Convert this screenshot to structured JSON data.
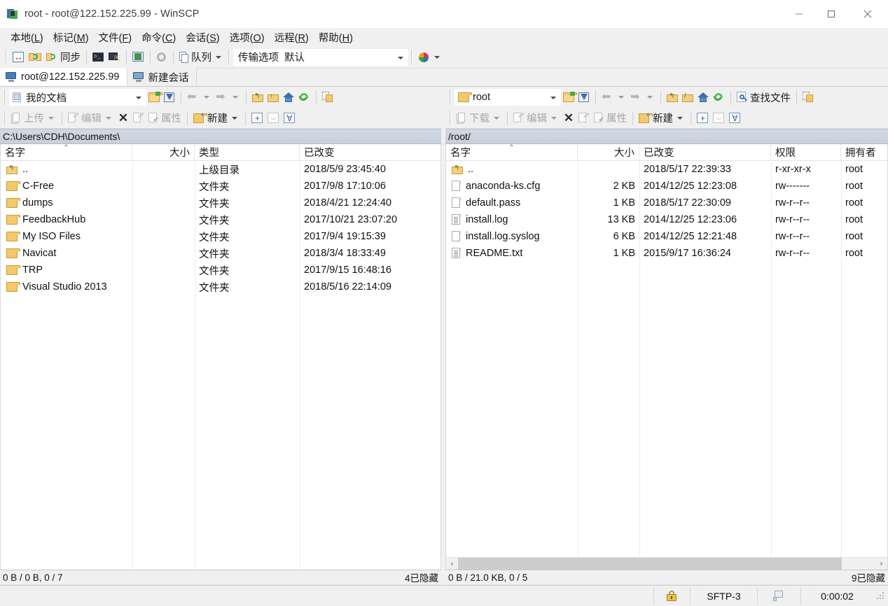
{
  "window": {
    "title": "root - root@122.152.225.99 - WinSCP",
    "app_icon": "winscp-icon",
    "minimize": "–",
    "maximize": "□",
    "close": "✕"
  },
  "menubar": [
    {
      "label": "本地",
      "accel": "L"
    },
    {
      "label": "标记",
      "accel": "M"
    },
    {
      "label": "文件",
      "accel": "F"
    },
    {
      "label": "命令",
      "accel": "C"
    },
    {
      "label": "会话",
      "accel": "S"
    },
    {
      "label": "选项",
      "accel": "O"
    },
    {
      "label": "远程",
      "accel": "R"
    },
    {
      "label": "帮助",
      "accel": "H"
    }
  ],
  "toolbar": {
    "sync_browsing_icon": "sync-browsing-icon",
    "synchronize_icon": "synchronize-icon",
    "refresh_sync_icon": "refresh-sync-icon",
    "sync_label": "同步",
    "terminal_icon": "terminal-icon",
    "putty_icon": "putty-icon",
    "commander_icon": "commander-view-icon",
    "preferences_icon": "gear-icon",
    "queue_icon": "queue-icon",
    "queue_label": "队列",
    "transfer_settings_label": "传输选项",
    "transfer_settings_value": "默认",
    "globe_icon": "globe-icon"
  },
  "tabs": [
    {
      "label": "root@122.152.225.99",
      "icon": "session-monitor-icon",
      "active": true
    },
    {
      "label": "新建会话",
      "icon": "new-session-icon",
      "active": false
    }
  ],
  "local_panel": {
    "drive_combo_value": "我的文档",
    "drive_icon": "my-documents-icon",
    "open_dir_icon": "open-directory-icon",
    "filter_icon": "filter-icon",
    "back_icon": "back-arrow-icon",
    "forward_icon": "forward-arrow-icon",
    "parent_icon": "parent-directory-icon",
    "root_icon": "root-directory-icon",
    "home_icon": "home-directory-icon",
    "refresh_icon": "refresh-icon",
    "copy_path_icon": "copy-path-icon",
    "ops": {
      "upload_label": "上传",
      "edit_label": "编辑",
      "delete_icon": "delete-icon",
      "properties_label": "属性",
      "new_label": "新建",
      "select_plus": "+",
      "select_minus": "–",
      "select_filter": "∀"
    },
    "path": "C:\\Users\\CDH\\Documents\\",
    "columns": [
      "名字",
      "大小",
      "类型",
      "已改变"
    ],
    "sort_column": 0,
    "rows": [
      {
        "icon": "parent-directory-icon",
        "name": "..",
        "size": "",
        "type": "上级目录",
        "changed": "2018/5/9  23:45:40"
      },
      {
        "icon": "folder-icon",
        "name": "C-Free",
        "size": "",
        "type": "文件夹",
        "changed": "2017/9/8  17:10:06"
      },
      {
        "icon": "folder-icon",
        "name": "dumps",
        "size": "",
        "type": "文件夹",
        "changed": "2018/4/21  12:24:40"
      },
      {
        "icon": "folder-icon",
        "name": "FeedbackHub",
        "size": "",
        "type": "文件夹",
        "changed": "2017/10/21  23:07:20"
      },
      {
        "icon": "folder-icon",
        "name": "My ISO Files",
        "size": "",
        "type": "文件夹",
        "changed": "2017/9/4  19:15:39"
      },
      {
        "icon": "folder-icon",
        "name": "Navicat",
        "size": "",
        "type": "文件夹",
        "changed": "2018/3/4  18:33:49"
      },
      {
        "icon": "folder-icon",
        "name": "TRP",
        "size": "",
        "type": "文件夹",
        "changed": "2017/9/15  16:48:16"
      },
      {
        "icon": "folder-icon",
        "name": "Visual Studio 2013",
        "size": "",
        "type": "文件夹",
        "changed": "2018/5/16  22:14:09"
      }
    ],
    "status_left": "0 B / 0 B,  0 / 7",
    "status_right": "4已隐藏"
  },
  "remote_panel": {
    "dir_combo_value": "root",
    "dir_icon": "folder-icon",
    "open_dir_icon": "open-directory-icon",
    "filter_icon": "filter-icon",
    "back_icon": "back-arrow-icon",
    "forward_icon": "forward-arrow-icon",
    "parent_icon": "parent-directory-icon",
    "root_icon": "root-directory-icon",
    "home_icon": "home-directory-icon",
    "refresh_icon": "refresh-icon",
    "find_files_icon": "find-files-icon",
    "find_files_label": "查找文件",
    "copy_path_icon": "copy-path-icon",
    "ops": {
      "download_label": "下载",
      "edit_label": "编辑",
      "delete_icon": "delete-icon",
      "properties_label": "属性",
      "new_label": "新建",
      "select_plus": "+",
      "select_minus": "–",
      "select_filter": "∀"
    },
    "path": "/root/",
    "columns": [
      "名字",
      "大小",
      "已改变",
      "权限",
      "拥有者"
    ],
    "sort_column": 0,
    "rows": [
      {
        "icon": "parent-directory-icon",
        "name": "..",
        "size": "",
        "changed": "2018/5/17 22:39:33",
        "rights": "r-xr-xr-x",
        "owner": "root"
      },
      {
        "icon": "file-icon",
        "name": "anaconda-ks.cfg",
        "size": "2 KB",
        "changed": "2014/12/25 12:23:08",
        "rights": "rw-------",
        "owner": "root"
      },
      {
        "icon": "file-icon",
        "name": "default.pass",
        "size": "1 KB",
        "changed": "2018/5/17 22:30:09",
        "rights": "rw-r--r--",
        "owner": "root"
      },
      {
        "icon": "text-file-icon",
        "name": "install.log",
        "size": "13 KB",
        "changed": "2014/12/25 12:23:06",
        "rights": "rw-r--r--",
        "owner": "root"
      },
      {
        "icon": "file-icon",
        "name": "install.log.syslog",
        "size": "6 KB",
        "changed": "2014/12/25 12:21:48",
        "rights": "rw-r--r--",
        "owner": "root"
      },
      {
        "icon": "text-file-icon",
        "name": "README.txt",
        "size": "1 KB",
        "changed": "2015/9/17 16:36:24",
        "rights": "rw-r--r--",
        "owner": "root"
      }
    ],
    "scroll_left_arrow": "‹",
    "scroll_right_arrow": "›",
    "status_left": "0 B / 21.0 KB,  0 / 5",
    "status_right": "9已隐藏"
  },
  "statusbar": {
    "lock_icon": "lock-icon",
    "protocol": "SFTP-3",
    "network_icon": "network-disconnect-icon",
    "elapsed": "0:00:02"
  },
  "colors": {
    "pathbar_bg": "#cfd6e0",
    "window_bg": "#f0f0f0",
    "list_bg": "#ffffff",
    "folder": "#f4c96a",
    "accent_green": "#3faa3f"
  }
}
